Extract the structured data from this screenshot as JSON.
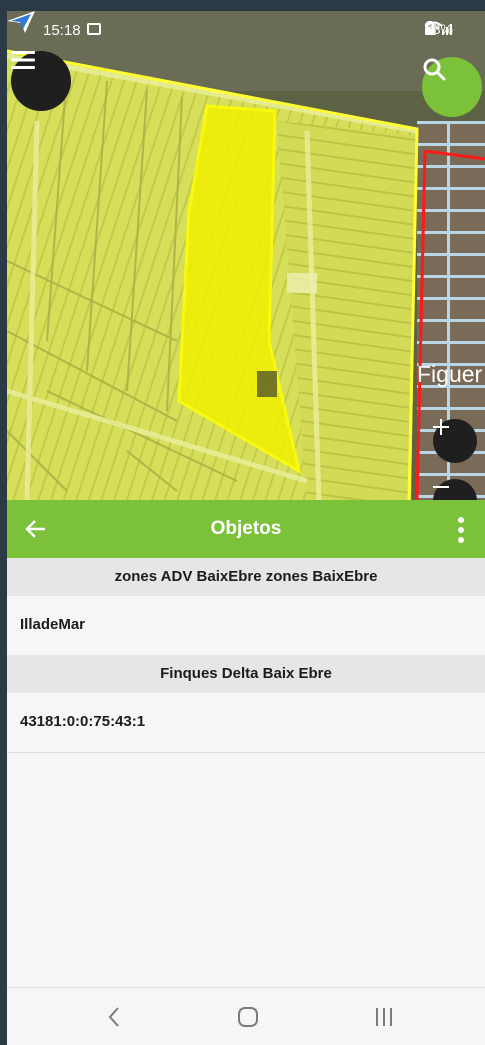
{
  "status_bar": {
    "time": "15:18",
    "battery": "48%"
  },
  "map": {
    "place_label": "Figuer"
  },
  "toolbar": {
    "title": "Objetos"
  },
  "groups": [
    {
      "header": "zones ADV BaixEbre zones BaixEbre",
      "items": [
        "IlladeMar"
      ]
    },
    {
      "header": "Finques Delta Baix Ebre",
      "items": [
        "43181:0:0:75:43:1"
      ]
    }
  ],
  "colors": {
    "accent": "#7cc13a",
    "dark_button": "#1f1f1f",
    "parcel_highlight": "#ffff00",
    "parcel_border_red": "#ff1a1a"
  },
  "icons": [
    "location-arrow-icon",
    "image-icon",
    "location-pin-icon",
    "wifi-icon",
    "signal-icon",
    "battery-icon",
    "menu-icon",
    "search-icon",
    "plus-icon",
    "minus-icon",
    "back-arrow-icon",
    "more-vert-icon",
    "nav-back-icon",
    "nav-home-icon",
    "nav-recents-icon"
  ]
}
